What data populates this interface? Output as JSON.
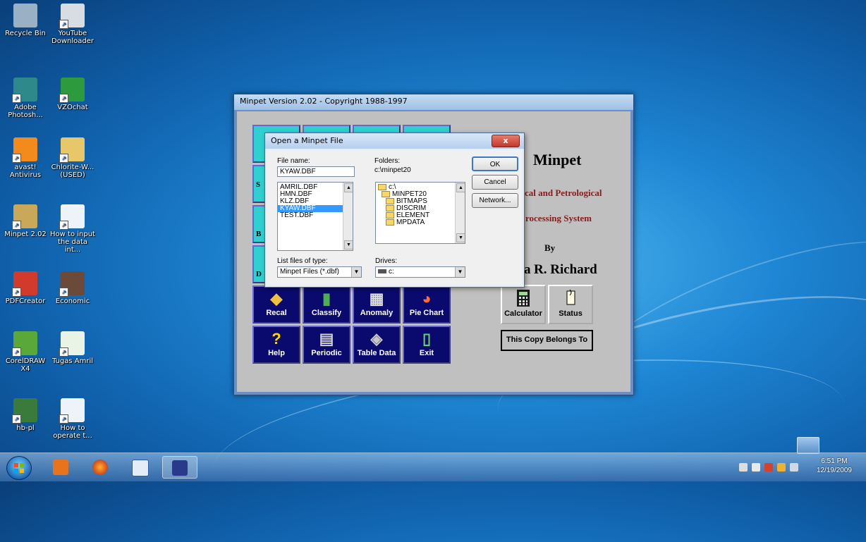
{
  "desktop": {
    "icons": [
      {
        "label": "Recycle Bin",
        "icon": "recycle-bin-icon",
        "color": "#9ab0c4"
      },
      {
        "label": "YouTube Downloader",
        "icon": "youtube-downloader-icon",
        "color": "#d8dde4"
      },
      {
        "label": "Adobe Photosh...",
        "icon": "photoshop-icon",
        "color": "#2e8a8a"
      },
      {
        "label": "VZOchat",
        "icon": "vzochat-icon",
        "color": "#2e9a3e"
      },
      {
        "label": "avast! Antivirus",
        "icon": "avast-icon",
        "color": "#f28a1c"
      },
      {
        "label": "Chlorite-W... (USED)",
        "icon": "folder-icon",
        "color": "#e8c66a"
      },
      {
        "label": "Minpet 2.02",
        "icon": "minpet-folder-icon",
        "color": "#c9a85a"
      },
      {
        "label": "How to input the data int...",
        "icon": "word-doc-icon",
        "color": "#eef3fa"
      },
      {
        "label": "PDFCreator",
        "icon": "pdfcreator-icon",
        "color": "#d23b2b"
      },
      {
        "label": "Economic",
        "icon": "economic-file-icon",
        "color": "#6b4a3a"
      },
      {
        "label": "CorelDRAW X4",
        "icon": "coreldraw-icon",
        "color": "#5aa83a"
      },
      {
        "label": "Tugas Amril",
        "icon": "excel-doc-icon",
        "color": "#e9f3e6"
      },
      {
        "label": "hb-pl",
        "icon": "hb-pl-icon",
        "color": "#3a7a3a"
      },
      {
        "label": "How to operate t...",
        "icon": "word-doc-icon",
        "color": "#eef3fa"
      }
    ]
  },
  "main_window": {
    "title": "Minpet Version 2.02 - Copyright 1988-1997",
    "heading": "Minpet",
    "subtitle1": "cal and Petrological",
    "subtitle2": "rocessing System",
    "by": "By",
    "author": "R. Richard",
    "author_prefix": "a",
    "partial_letters": [
      "S",
      "B",
      "D"
    ],
    "tools": [
      {
        "label": "Recal",
        "icon": "diamond-icon"
      },
      {
        "label": "Classify",
        "icon": "cylinder-icon"
      },
      {
        "label": "Anomaly",
        "icon": "grid-icon"
      },
      {
        "label": "Pie Chart",
        "icon": "pie-chart-icon"
      },
      {
        "label": "Help",
        "icon": "question-icon"
      },
      {
        "label": "Periodic",
        "icon": "periodic-icon"
      },
      {
        "label": "Table Data",
        "icon": "table-data-icon"
      },
      {
        "label": "Exit",
        "icon": "exit-door-icon"
      }
    ],
    "calculator_label": "Calculator",
    "status_label": "Status",
    "belongs_label": "This Copy Belongs To"
  },
  "dialog": {
    "title": "Open a Minpet File",
    "close_label": "x",
    "file_name_label": "File name:",
    "file_name_value": "KYAW.DBF",
    "files": [
      "AMRIL.DBF",
      "HMN.DBF",
      "KLZ.DBF",
      "KYAW.DBF",
      "TEST.DBF"
    ],
    "selected_file": "KYAW.DBF",
    "folders_label": "Folders:",
    "current_folder": "c:\\minpet20",
    "folders": [
      "c:\\",
      "MINPET20",
      "BITMAPS",
      "DISCRIM",
      "ELEMENT",
      "MPDATA"
    ],
    "list_type_label": "List files of type:",
    "list_type_value": "Minpet Files (*.dbf)",
    "drives_label": "Drives:",
    "drive_value": "c:",
    "ok_label": "OK",
    "cancel_label": "Cancel",
    "network_label": "Network..."
  },
  "taskbar": {
    "time": "6:51 PM",
    "date": "12/19/2009",
    "items": [
      "media-player-icon",
      "firefox-icon",
      "word-icon",
      "minpet-icon"
    ]
  }
}
